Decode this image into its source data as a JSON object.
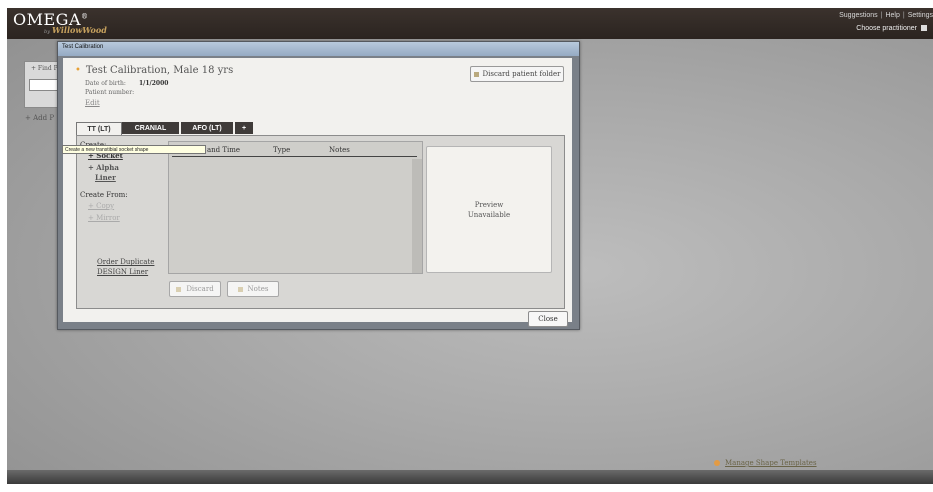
{
  "app": {
    "logo": "OMEGA",
    "logo_mark": "®",
    "logo_sub_prefix": "by",
    "logo_sub": "WillowWood",
    "top_links": [
      "Suggestions",
      "Help",
      "Settings"
    ],
    "choose_practitioner": "Choose practitioner"
  },
  "background": {
    "find_label": "+ Find P",
    "add_label": "+ Add P",
    "manage_templates": "Manage Shape Templates"
  },
  "dialog": {
    "title": "Test Calibration",
    "patient_name": "Test Calibration,  Male 18 yrs",
    "dob_label": "Date of birth:",
    "dob_value": "1/1/2000",
    "patient_number_label": "Patient number:",
    "edit_label": "Edit",
    "discard_folder": "Discard patient folder",
    "tabs": [
      "TT (LT)",
      "CRANIAL",
      "AFO (LT)",
      "+"
    ],
    "create_label": "Create:",
    "create_items": [
      "+ Socket",
      "+ Alpha",
      "Liner"
    ],
    "create_from_label": "Create From:",
    "create_from_items": [
      "+ Copy",
      "+ Mirror"
    ],
    "order_duplicate": [
      "Order Duplicate",
      "DESIGN Liner"
    ],
    "table_headers": [
      "Date and Time",
      "Type",
      "Notes"
    ],
    "preview_text": [
      "Preview",
      "Unavailable"
    ],
    "discard_button": "Discard",
    "notes_button": "Notes",
    "close_button": "Close",
    "tooltip": "Create a new transtibial socket shape"
  }
}
